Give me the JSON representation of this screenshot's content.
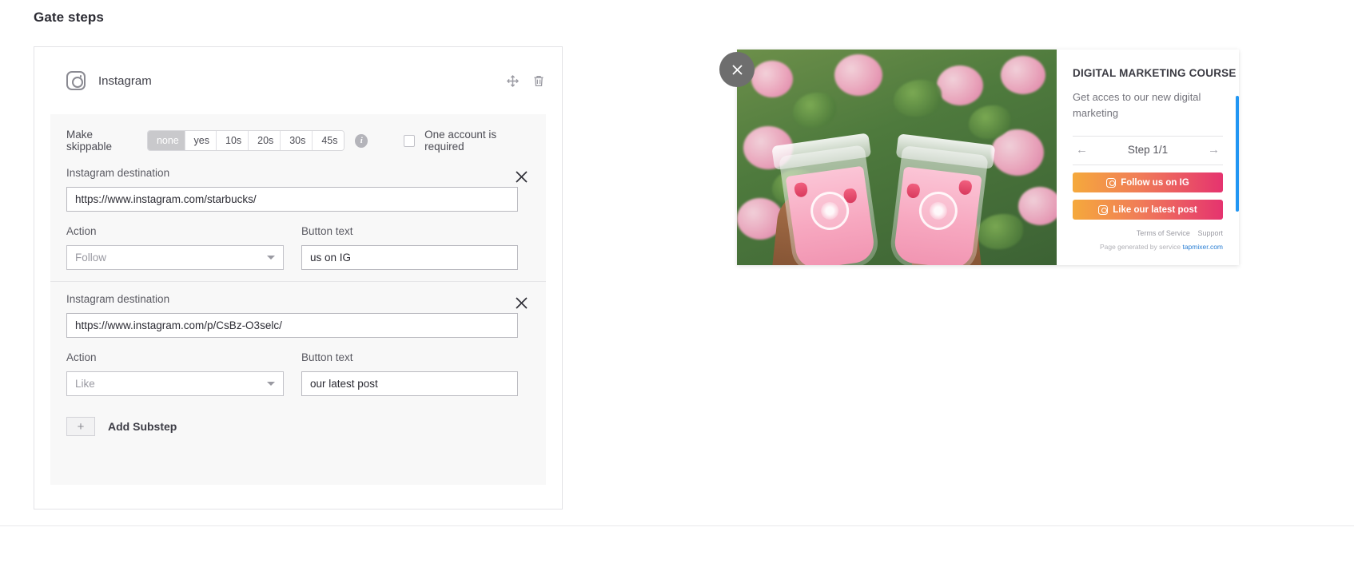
{
  "page_title": "Gate steps",
  "step_card": {
    "platform": "Instagram",
    "platform_icon": "instagram-icon",
    "drag_icon": "drag-handle-icon",
    "delete_icon": "trash-icon",
    "skippable": {
      "label": "Make skippable",
      "options": [
        "none",
        "yes",
        "10s",
        "20s",
        "30s",
        "45s"
      ],
      "selected": "none",
      "info_icon": "info-icon"
    },
    "account_required": {
      "label": "One account is required",
      "checked": false
    },
    "substeps": [
      {
        "destination_label": "Instagram destination",
        "destination_value": "https://www.instagram.com/starbucks/",
        "action_label": "Action",
        "action_value": "Follow",
        "button_text_label": "Button text",
        "button_text_value": "us on IG",
        "remove_icon": "close-icon"
      },
      {
        "destination_label": "Instagram destination",
        "destination_value": "https://www.instagram.com/p/CsBz-O3selc/",
        "action_label": "Action",
        "action_value": "Like",
        "button_text_label": "Button text",
        "button_text_value": "our latest post",
        "remove_icon": "close-icon"
      }
    ],
    "add_substep": {
      "plus": "+",
      "label": "Add Substep"
    }
  },
  "preview": {
    "close_label": "×",
    "title": "DIGITAL MARKETING COURSE",
    "subtitle": "Get acces to our new digital marketing",
    "prev_arrow": "←",
    "next_arrow": "→",
    "step_label": "Step 1/1",
    "buttons": [
      {
        "label": "Follow us on IG",
        "icon": "instagram-icon"
      },
      {
        "label": "Like our latest post",
        "icon": "instagram-icon"
      }
    ],
    "footer": {
      "terms": "Terms of Service",
      "support": "Support",
      "generated_prefix": "Page generated by service",
      "generated_link": "tapmixer.com"
    },
    "accent_color": "#e5336f",
    "scrollbar_color": "#2196f3"
  }
}
